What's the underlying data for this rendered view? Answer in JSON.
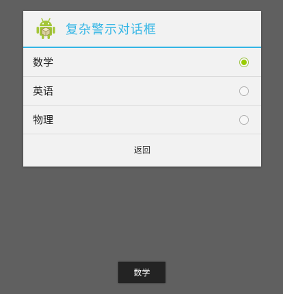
{
  "dialog": {
    "title": "复杂警示对话框",
    "icon": "android-icon",
    "options": [
      {
        "label": "数学",
        "checked": true
      },
      {
        "label": "英语",
        "checked": false
      },
      {
        "label": "物理",
        "checked": false
      }
    ],
    "button_label": "返回"
  },
  "toast": {
    "text": "数学"
  },
  "colors": {
    "accent": "#33b5e5",
    "radio_checked": "#99cc00",
    "android_green": "#a4c639",
    "background": "#606060"
  }
}
